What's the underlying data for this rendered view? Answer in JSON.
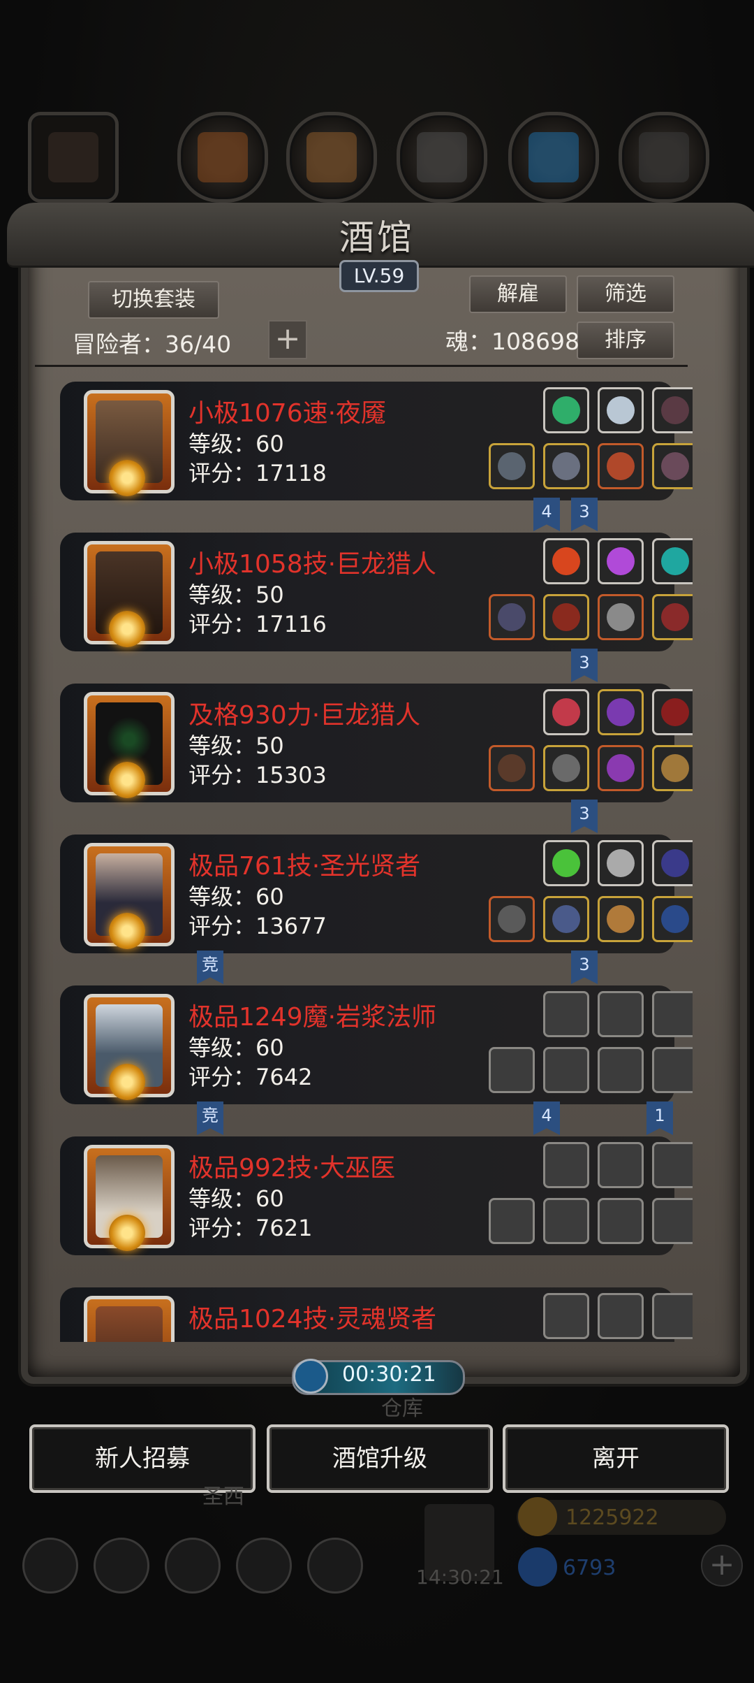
{
  "tavern": {
    "title": "酒馆",
    "level": "LV.59",
    "switch_outfit_label": "切换套装",
    "dismiss_label": "解雇",
    "filter_label": "筛选",
    "sort_label": "排序",
    "adventurers_label": "冒险者：36/40",
    "soul_label": "魂：108698"
  },
  "heroes": [
    {
      "name": "小极1076速·夜魇",
      "level": "等级：60",
      "score": "评分：17118"
    },
    {
      "name": "小极1058技·巨龙猎人",
      "level": "等级：50",
      "score": "评分：17116"
    },
    {
      "name": "及格930力·巨龙猎人",
      "level": "等级：50",
      "score": "评分：15303"
    },
    {
      "name": "极品761技·圣光贤者",
      "level": "等级：60",
      "score": "评分：13677"
    },
    {
      "name": "极品1249魔·岩浆法师",
      "level": "等级：60",
      "score": "评分：7642"
    },
    {
      "name": "极品992技·大巫医",
      "level": "等级：60",
      "score": "评分：7621"
    },
    {
      "name": "极品1024技·灵魂贤者",
      "level": "",
      "score": ""
    }
  ],
  "ribbons": {
    "r1": "4",
    "r2": "3",
    "r3": "3",
    "r4": "3",
    "r5": "竞",
    "r6": "3",
    "r7": "竞",
    "r8": "4",
    "r9": "1"
  },
  "timer": "00:30:21",
  "bottom_buttons": {
    "recruit": "新人招募",
    "upgrade": "酒馆升级",
    "leave": "离开"
  },
  "background": {
    "warehouse": "仓库",
    "west": "圣西",
    "gift_time": "14:30:21",
    "gold": "1225922",
    "gems": "6793"
  },
  "icons": {
    "clock": "clock-icon",
    "plus": "plus-icon",
    "gift": "gift-icon",
    "gold": "gold-coin-icon",
    "gem": "gem-icon"
  },
  "colors": {
    "hero_name": "#e2332b",
    "ribbon": "#2c4f80",
    "timer_fill": "#1d6b80"
  }
}
